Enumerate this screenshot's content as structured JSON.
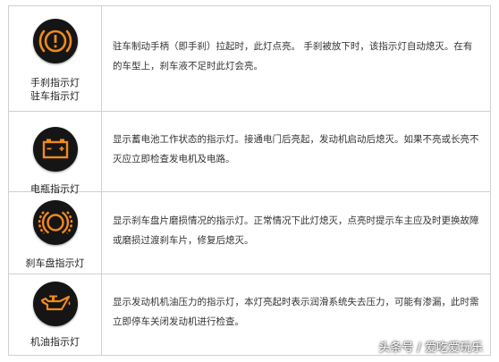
{
  "rows": [
    {
      "icon": "parking-brake-warning-icon",
      "labels": [
        "手刹指示灯",
        "驻车指示灯"
      ],
      "description": "驻车制动手柄（即手刹）拉起时，此灯点亮。 手刹被放下时，该指示灯自动熄灭。在有的车型上，刹车液不足时此灯会亮。"
    },
    {
      "icon": "battery-warning-icon",
      "labels": [
        "电瓶指示灯"
      ],
      "description": "显示蓄电池工作状态的指示灯。接通电门后亮起，发动机启动后熄灭。如果不亮或长亮不灭应立即检查发电机及电路。"
    },
    {
      "icon": "brake-pad-wear-icon",
      "labels": [
        "刹车盘指示灯"
      ],
      "description": "显示刹车盘片磨损情况的指示灯。正常情况下此灯熄灭，点亮时提示车主应及时更换故障或磨损过渡刹车片，修复后熄灭。"
    },
    {
      "icon": "oil-pressure-icon",
      "labels": [
        "机油指示灯"
      ],
      "description": "显示发动机机油压力的指示灯，本灯亮起时表示润滑系统失去压力，可能有渗漏，此时需立即停车关闭发动机进行检查。"
    }
  ],
  "watermark": "头条号 / 爱吃爱玩乐",
  "colors": {
    "icon_orange": "#f08a1c",
    "icon_background": "#151515",
    "grid_line": "#d0d0d0"
  }
}
